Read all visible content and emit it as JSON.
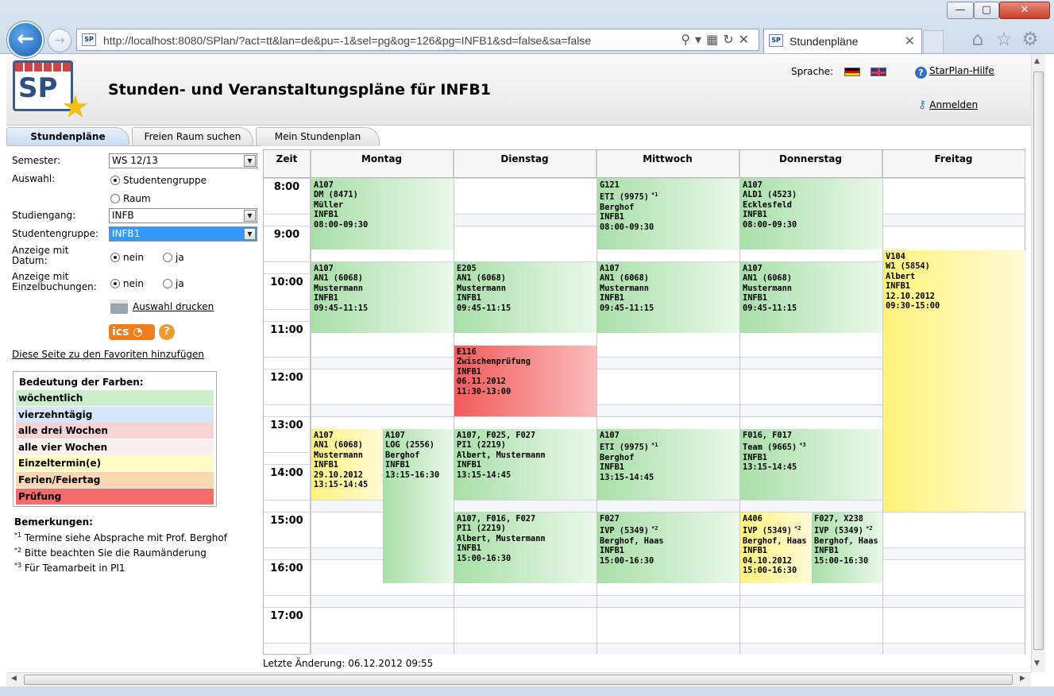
{
  "browser": {
    "url": "http://localhost:8080/SPlan/?act=tt&lan=de&pu=-1&sel=pg&og=126&pg=INFB1&sd=false&sa=false",
    "tab_title": "Stundenpläne",
    "favicon_text": "SP"
  },
  "header": {
    "logo_text": "SP",
    "title": "Stunden- und Veranstaltungspläne für INFB1",
    "language_label": "Sprache:",
    "help_link": "StarPlan-Hilfe",
    "login_link": "Anmelden"
  },
  "tabs": [
    "Stundenpläne",
    "Freien Raum suchen",
    "Mein Stundenplan"
  ],
  "form": {
    "semester_label": "Semester:",
    "semester_value": "WS 12/13",
    "selection_label": "Auswahl:",
    "selection_options": [
      "Studentengruppe",
      "Raum"
    ],
    "program_label": "Studiengang:",
    "program_value": "INFB",
    "group_label": "Studentengruppe:",
    "group_value": "INFB1",
    "date_label_1": "Anzeige mit",
    "date_label_2": "Datum:",
    "single_label_1": "Anzeige mit",
    "single_label_2": "Einzelbuchungen:",
    "no": "nein",
    "yes": "ja",
    "print_link": "Auswahl drucken",
    "ics_label": "ics",
    "favorites_link": "Diese Seite zu den Favoriten hinzufügen"
  },
  "legend": {
    "title": "Bedeutung der Farben:",
    "items": [
      {
        "label": "wöchentlich",
        "color": "#cdeecd"
      },
      {
        "label": "vierzehntägig",
        "color": "#d6e6fa"
      },
      {
        "label": "alle drei Wochen",
        "color": "#f7d4d4"
      },
      {
        "label": "alle vier Wochen",
        "color": "#f7efef"
      },
      {
        "label": "Einzeltermin(e)",
        "color": "#fffbc4"
      },
      {
        "label": "Ferien/Feiertag",
        "color": "#f9d7b0"
      },
      {
        "label": "Prüfung",
        "color": "#f56b6b"
      }
    ]
  },
  "notes": {
    "title": "Bemerkungen:",
    "items": [
      {
        "mark": "*1",
        "text": "Termine siehe Absprache mit Prof. Berghof"
      },
      {
        "mark": "*2",
        "text": "Bitte beachten Sie die Raumänderung"
      },
      {
        "mark": "*3",
        "text": "Für Teamarbeit in PI1"
      }
    ]
  },
  "timetable": {
    "time_header": "Zeit",
    "days": [
      "Montag",
      "Dienstag",
      "Mittwoch",
      "Donnerstag",
      "Freitag"
    ],
    "hours": [
      "8:00",
      "9:00",
      "10:00",
      "11:00",
      "12:00",
      "13:00",
      "14:00",
      "15:00",
      "16:00",
      "17:00"
    ],
    "events": [
      {
        "day": 0,
        "start": "08:00",
        "end": "09:30",
        "lane": 0,
        "lanes": 1,
        "kind": "weekly",
        "lines": [
          "A107",
          "DM (8471)",
          "Müller",
          "INFB1",
          "08:00-09:30"
        ],
        "note": ""
      },
      {
        "day": 2,
        "start": "08:00",
        "end": "09:30",
        "lane": 0,
        "lanes": 1,
        "kind": "weekly",
        "lines": [
          "G121",
          "ETI (9975)",
          "Berghof",
          "INFB1",
          "08:00-09:30"
        ],
        "note": "*1"
      },
      {
        "day": 3,
        "start": "08:00",
        "end": "09:30",
        "lane": 0,
        "lanes": 1,
        "kind": "weekly",
        "lines": [
          "A107",
          "ALD1 (4523)",
          "Ecklesfeld",
          "INFB1",
          "08:00-09:30"
        ],
        "note": ""
      },
      {
        "day": 0,
        "start": "09:45",
        "end": "11:15",
        "lane": 0,
        "lanes": 1,
        "kind": "weekly",
        "lines": [
          "A107",
          "AN1 (6068)",
          "Mustermann",
          "INFB1",
          "09:45-11:15"
        ],
        "note": ""
      },
      {
        "day": 1,
        "start": "09:45",
        "end": "11:15",
        "lane": 0,
        "lanes": 1,
        "kind": "weekly",
        "lines": [
          "E205",
          "AN1 (6068)",
          "Mustermann",
          "INFB1",
          "09:45-11:15"
        ],
        "note": ""
      },
      {
        "day": 2,
        "start": "09:45",
        "end": "11:15",
        "lane": 0,
        "lanes": 1,
        "kind": "weekly",
        "lines": [
          "A107",
          "AN1 (6068)",
          "Mustermann",
          "INFB1",
          "09:45-11:15"
        ],
        "note": ""
      },
      {
        "day": 3,
        "start": "09:45",
        "end": "11:15",
        "lane": 0,
        "lanes": 1,
        "kind": "weekly",
        "lines": [
          "A107",
          "AN1 (6068)",
          "Mustermann",
          "INFB1",
          "09:45-11:15"
        ],
        "note": ""
      },
      {
        "day": 4,
        "start": "09:30",
        "end": "15:00",
        "lane": 0,
        "lanes": 1,
        "kind": "single",
        "lines": [
          "V104",
          "W1 (5854)",
          "Albert",
          "INFB1",
          "12.10.2012",
          "09:30-15:00"
        ],
        "note": ""
      },
      {
        "day": 1,
        "start": "11:30",
        "end": "13:00",
        "lane": 0,
        "lanes": 1,
        "kind": "exam",
        "lines": [
          "E116",
          "Zwischenprüfung",
          "INFB1",
          "06.11.2012",
          "11:30-13:00"
        ],
        "note": ""
      },
      {
        "day": 0,
        "start": "13:15",
        "end": "14:45",
        "lane": 0,
        "lanes": 2,
        "kind": "single",
        "lines": [
          "A107",
          "AN1 (6068)",
          "Mustermann",
          "INFB1",
          "29.10.2012",
          "13:15-14:45"
        ],
        "note": ""
      },
      {
        "day": 0,
        "start": "13:15",
        "end": "16:30",
        "lane": 1,
        "lanes": 2,
        "kind": "weekly",
        "lines": [
          "A107",
          "LOG (2556)",
          "Berghof",
          "INFB1",
          "13:15-16:30"
        ],
        "note": ""
      },
      {
        "day": 1,
        "start": "13:15",
        "end": "14:45",
        "lane": 0,
        "lanes": 1,
        "kind": "weekly",
        "lines": [
          "A107, F025, F027",
          "PI1 (2219)",
          "Albert, Mustermann",
          "INFB1",
          "13:15-14:45"
        ],
        "note": ""
      },
      {
        "day": 2,
        "start": "13:15",
        "end": "14:45",
        "lane": 0,
        "lanes": 1,
        "kind": "weekly",
        "lines": [
          "A107",
          "ETI (9975)",
          "Berghof",
          "INFB1",
          "13:15-14:45"
        ],
        "note": "*1"
      },
      {
        "day": 3,
        "start": "13:15",
        "end": "14:45",
        "lane": 0,
        "lanes": 1,
        "kind": "weekly",
        "lines": [
          "F016, F017",
          "Team (9665)",
          "INFB1",
          "13:15-14:45"
        ],
        "note": "*3"
      },
      {
        "day": 1,
        "start": "15:00",
        "end": "16:30",
        "lane": 0,
        "lanes": 1,
        "kind": "weekly",
        "lines": [
          "A107, F016, F027",
          "PI1 (2219)",
          "Albert, Mustermann",
          "INFB1",
          "15:00-16:30"
        ],
        "note": ""
      },
      {
        "day": 2,
        "start": "15:00",
        "end": "16:30",
        "lane": 0,
        "lanes": 1,
        "kind": "weekly",
        "lines": [
          "F027",
          "IVP (5349)",
          "Berghof, Haas",
          "INFB1",
          "15:00-16:30"
        ],
        "note": "*2"
      },
      {
        "day": 3,
        "start": "15:00",
        "end": "16:30",
        "lane": 0,
        "lanes": 2,
        "kind": "single",
        "lines": [
          "A406",
          "IVP (5349)",
          "Berghof, Haas",
          "INFB1",
          "04.10.2012",
          "15:00-16:30"
        ],
        "note": "*2"
      },
      {
        "day": 3,
        "start": "15:00",
        "end": "16:30",
        "lane": 1,
        "lanes": 2,
        "kind": "weekly",
        "lines": [
          "F027, X238",
          "IVP (5349)",
          "Berghof, Haas",
          "INFB1",
          "15:00-16:30"
        ],
        "note": "*2"
      }
    ]
  },
  "footer": {
    "last_change": "Letzte Änderung: 06.12.2012 09:55"
  }
}
